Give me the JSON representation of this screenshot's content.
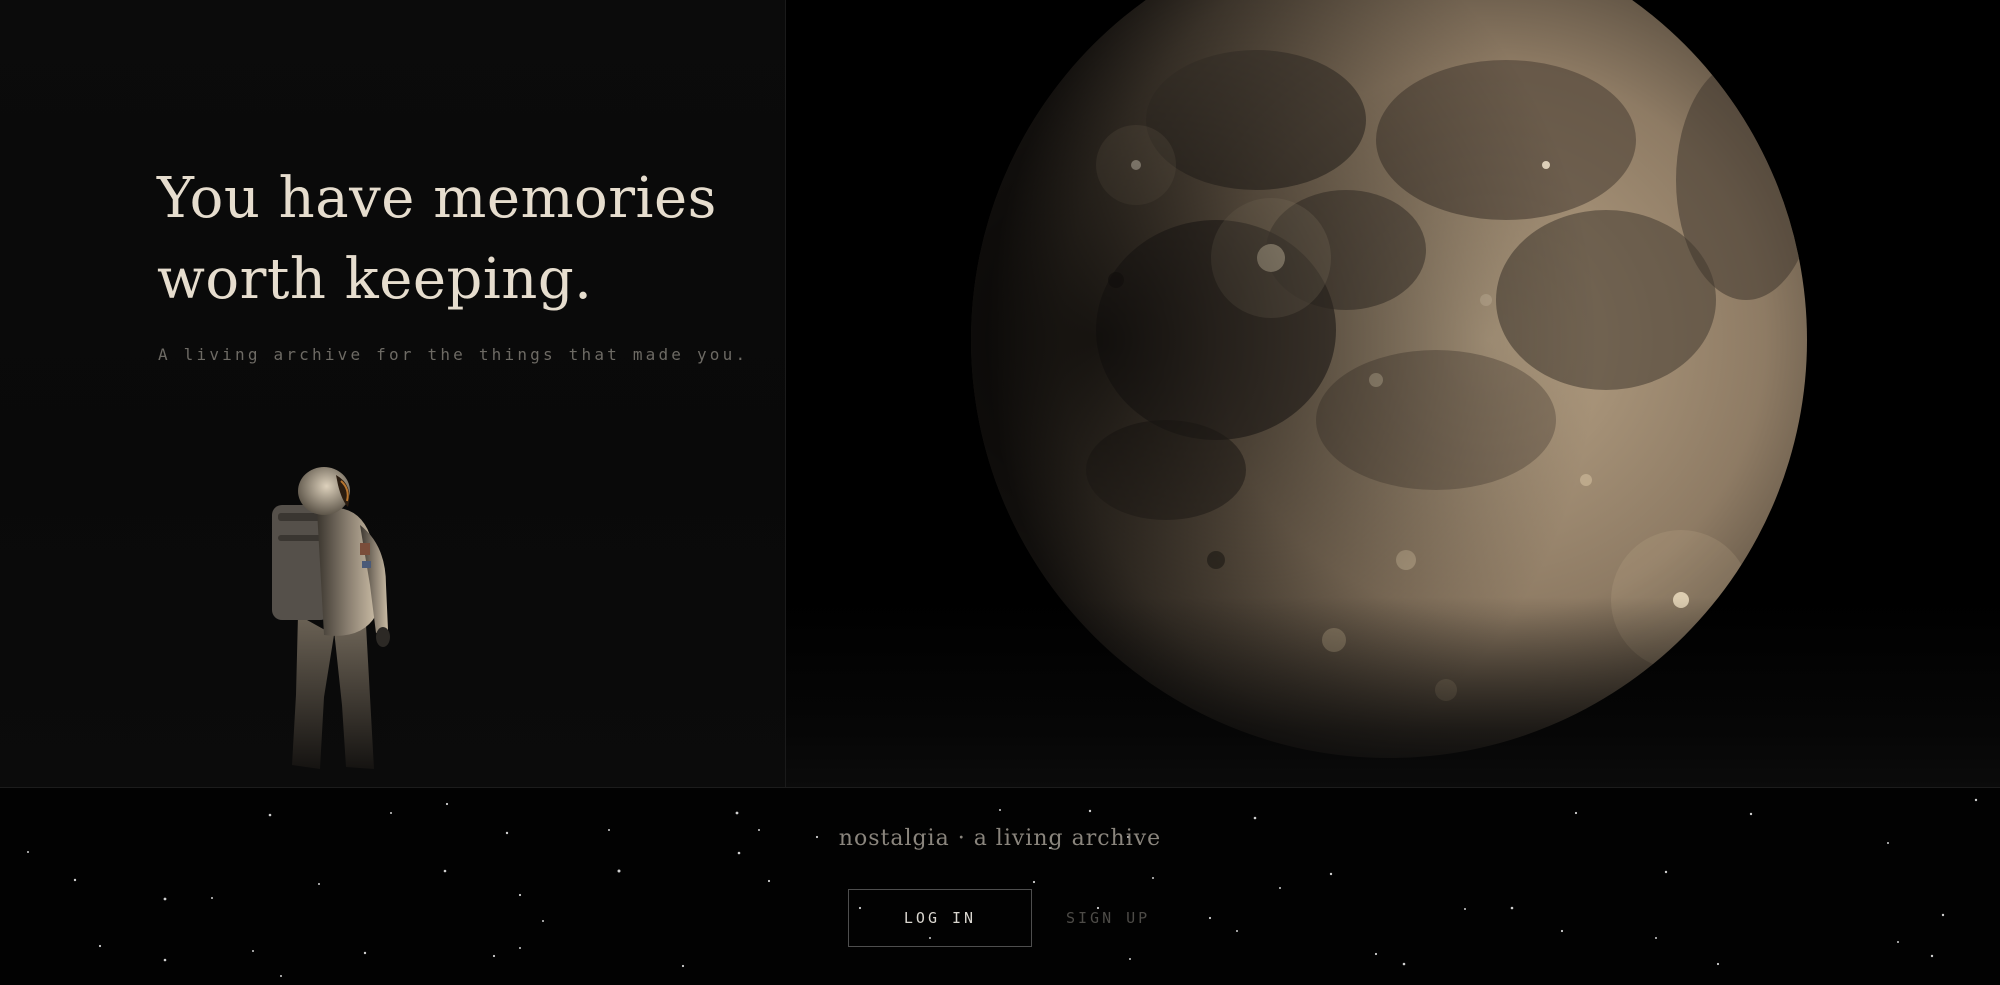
{
  "hero": {
    "headline_line1": "You have memories",
    "headline_line2": "worth keeping.",
    "subtitle": "A living archive for the things that made you."
  },
  "imagery": {
    "left_figure": "astronaut-illustration",
    "right_figure": "moon-illustration",
    "footer_background": "star-field"
  },
  "footer": {
    "brand": "nostalgia · a living archive",
    "login_label": "LOG IN",
    "signup_label": "SIGN UP"
  },
  "colors": {
    "headline": "#e6ddce",
    "subtitle": "#6d6a64",
    "background": "#030303",
    "panel": "#0b0b0b",
    "moon_light": "#bfa88a",
    "moon_dark": "#3a3128",
    "button_border": "#4e4e4e"
  }
}
